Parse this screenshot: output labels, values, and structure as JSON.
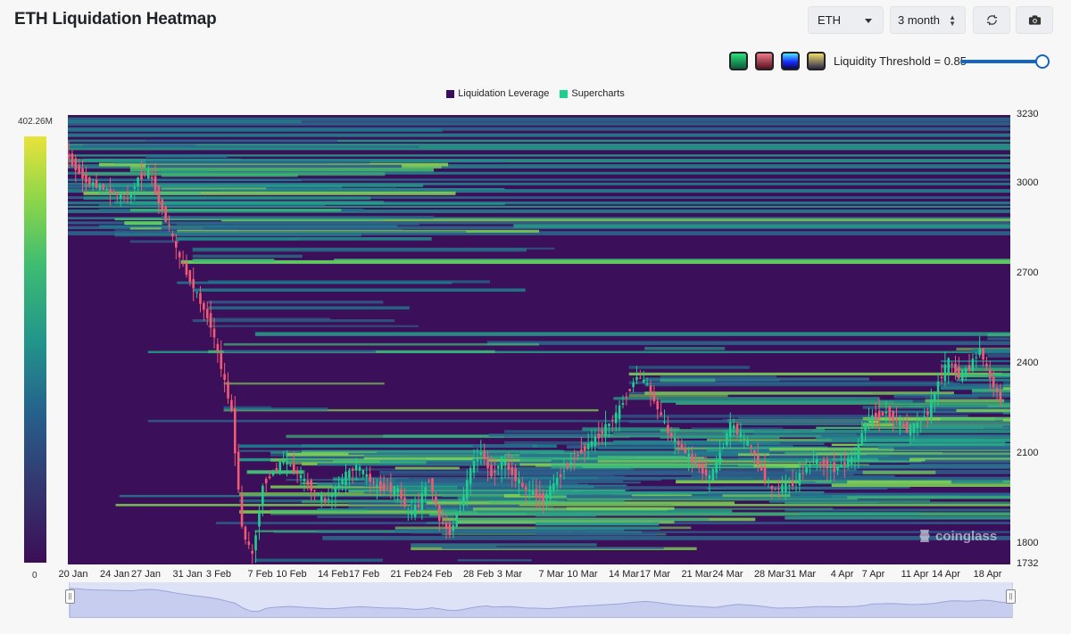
{
  "header": {
    "title": "ETH Liquidation Heatmap",
    "coin_value": "ETH",
    "range_value": "3 month",
    "refresh_icon": "refresh-icon",
    "camera_icon": "camera-icon"
  },
  "controls": {
    "palettes": [
      "green",
      "red",
      "blue",
      "yellow"
    ],
    "threshold_label": "Liquidity Threshold = 0.85",
    "threshold_value": 0.85
  },
  "legend": [
    {
      "label": "Liquidation Leverage",
      "color": "#3a0e5a"
    },
    {
      "label": "Supercharts",
      "color": "#1fcf8e"
    }
  ],
  "colorbar": {
    "max_label": "402.26M",
    "min_label": "0"
  },
  "watermark": "coinglass",
  "chart_data": {
    "type": "heatmap",
    "title": "ETH Liquidation Heatmap",
    "y_ticks": [
      1732,
      1800,
      2100,
      2400,
      2700,
      3000,
      3230
    ],
    "ylim": [
      1732,
      3230
    ],
    "x_ticks": [
      "20 Jan",
      "24 Jan",
      "27 Jan",
      "31 Jan",
      "3 Feb",
      "7 Feb",
      "10 Feb",
      "14 Feb",
      "17 Feb",
      "21 Feb",
      "24 Feb",
      "28 Feb",
      "3 Mar",
      "7 Mar",
      "10 Mar",
      "14 Mar",
      "17 Mar",
      "21 Mar",
      "24 Mar",
      "28 Mar",
      "31 Mar",
      "4 Apr",
      "7 Apr",
      "11 Apr",
      "14 Apr",
      "18 Apr"
    ],
    "colorbar_range": [
      0,
      402260000
    ],
    "price_series": {
      "name": "ETH price",
      "x": [
        "20 Jan",
        "22 Jan",
        "24 Jan",
        "26 Jan",
        "27 Jan",
        "28 Jan",
        "30 Jan",
        "31 Jan",
        "1 Feb",
        "3 Feb",
        "5 Feb",
        "6 Feb",
        "7 Feb",
        "8 Feb",
        "10 Feb",
        "12 Feb",
        "14 Feb",
        "16 Feb",
        "17 Feb",
        "19 Feb",
        "21 Feb",
        "22 Feb",
        "23 Feb",
        "24 Feb",
        "25 Feb",
        "26 Feb",
        "27 Feb",
        "28 Feb",
        "1 Mar",
        "2 Mar",
        "3 Mar",
        "5 Mar",
        "7 Mar",
        "9 Mar",
        "10 Mar",
        "12 Mar",
        "14 Mar",
        "15 Mar",
        "16 Mar",
        "17 Mar",
        "19 Mar",
        "21 Mar",
        "23 Mar",
        "24 Mar",
        "25 Mar",
        "27 Mar",
        "28 Mar",
        "29 Mar",
        "31 Mar",
        "2 Apr",
        "4 Apr",
        "6 Apr",
        "7 Apr",
        "9 Apr",
        "11 Apr",
        "12 Apr",
        "13 Apr",
        "14 Apr",
        "15 Apr",
        "16 Apr",
        "17 Apr",
        "18 Apr",
        "19 Apr",
        "20 Apr"
      ],
      "y": [
        3100,
        3010,
        2980,
        2950,
        3020,
        3040,
        2850,
        2750,
        2680,
        2530,
        2240,
        1850,
        1760,
        2000,
        2080,
        2010,
        1940,
        2030,
        2060,
        1990,
        1980,
        1900,
        1930,
        2020,
        1880,
        1840,
        1920,
        2050,
        2110,
        2030,
        2080,
        1990,
        1950,
        2050,
        2090,
        2150,
        2230,
        2300,
        2360,
        2330,
        2170,
        2090,
        2020,
        2100,
        2200,
        2120,
        2040,
        1980,
        2000,
        2080,
        2050,
        2090,
        2210,
        2240,
        2180,
        2200,
        2240,
        2340,
        2410,
        2360,
        2390,
        2450,
        2350,
        2280
      ]
    },
    "grid": false,
    "legend_placement": "top-center"
  },
  "navigator": {
    "left_handle_label": "||",
    "right_handle_label": "||"
  }
}
